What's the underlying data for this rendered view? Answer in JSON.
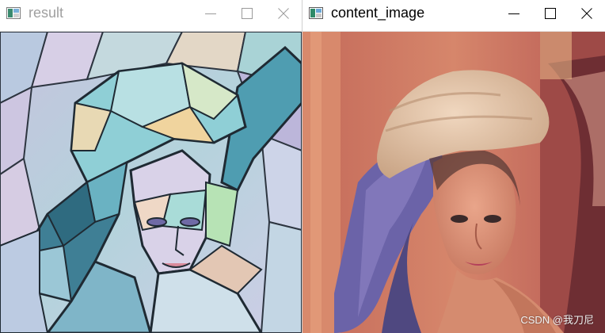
{
  "windows": {
    "result": {
      "title": "result",
      "icon": "window-app-icon",
      "active": false
    },
    "content_image": {
      "title": "content_image",
      "icon": "window-app-icon",
      "active": true
    }
  },
  "controls": [
    "minimize-icon",
    "maximize-icon",
    "close-icon"
  ],
  "watermark": "CSDN @我刀尼",
  "colors": {
    "inactive_title": "#a0a0a0",
    "active_title": "#000000",
    "stylized_teal": "#5fa7b8",
    "stylized_lavender": "#c9c4e3",
    "photo_skin": "#d7876a",
    "photo_background": "#c76e5e",
    "photo_hair_feather": "#6b63a8",
    "photo_hat": "#e6c6a9"
  }
}
